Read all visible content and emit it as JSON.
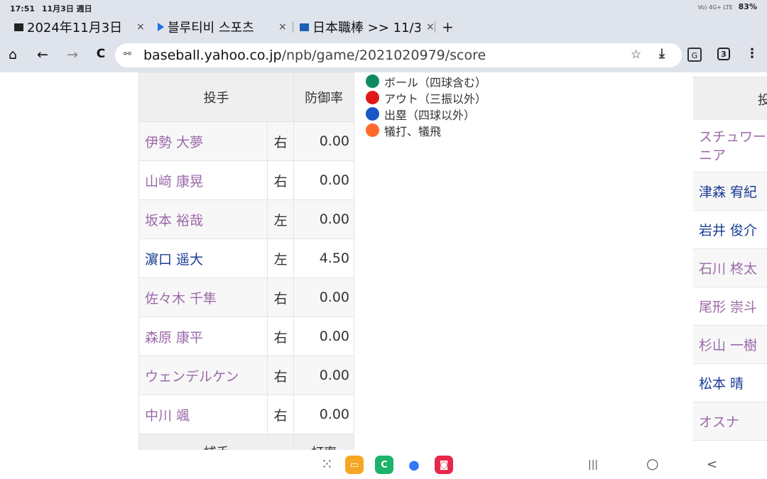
{
  "status_bar": {
    "time": "17:51",
    "date": "11月3日 週日",
    "signal": "Vo) 4G+ LTE",
    "battery": "83%"
  },
  "tabs": [
    {
      "label": "2024年11月3日",
      "close": "×",
      "color": "#222222"
    },
    {
      "label": "블루티비 스포츠",
      "close": "×",
      "color": "#1a73e8"
    },
    {
      "label": "日本職棒 >> 11/3",
      "close": "×",
      "color": "#1c5fb5"
    }
  ],
  "new_tab": "+",
  "toolbar": {
    "home_icon": "⌂",
    "back_icon": "←",
    "forward_icon": "→",
    "reload_icon": "C",
    "url_host": "baseball.yahoo.co.jp",
    "url_path": "/npb/game/2021020979/score",
    "star_icon": "☆",
    "download_icon": "⤓",
    "translate_icon": "G",
    "tab_count": "3",
    "menu_icon": "⋮"
  },
  "pitchers": {
    "headers": {
      "name": "投手",
      "era": "防御率"
    },
    "rows": [
      {
        "name": "伊勢 大夢",
        "hand": "右",
        "era": "0.00",
        "visited": true
      },
      {
        "name": "山﨑 康晃",
        "hand": "右",
        "era": "0.00",
        "visited": true
      },
      {
        "name": "坂本 裕哉",
        "hand": "左",
        "era": "0.00",
        "visited": true
      },
      {
        "name": "濵口 遥大",
        "hand": "左",
        "era": "4.50",
        "visited": false
      },
      {
        "name": "佐々木 千隼",
        "hand": "右",
        "era": "0.00",
        "visited": true
      },
      {
        "name": "森原 康平",
        "hand": "右",
        "era": "0.00",
        "visited": true
      },
      {
        "name": "ウェンデルケン",
        "hand": "右",
        "era": "0.00",
        "visited": true
      },
      {
        "name": "中川 颯",
        "hand": "右",
        "era": "0.00",
        "visited": true
      }
    ],
    "catcher_headers": {
      "name": "捕手",
      "avg": "打率"
    }
  },
  "legend": [
    {
      "label": "ボール（四球含む）",
      "color": "#0e8a5f"
    },
    {
      "label": "アウト（三振以外）",
      "color": "#e01818"
    },
    {
      "label": "出塁（四球以外）",
      "color": "#1a56c4"
    },
    {
      "label": "犠打、犠飛",
      "color": "#ff6a2a"
    }
  ],
  "right_table": {
    "header": "投",
    "rows": [
      {
        "name": "スチュワー ニア",
        "visited": true
      },
      {
        "name": "津森 宥紀",
        "visited": false
      },
      {
        "name": "岩井 俊介",
        "visited": false
      },
      {
        "name": "石川 柊太",
        "visited": true
      },
      {
        "name": "尾形 崇斗",
        "visited": true
      },
      {
        "name": "杉山 一樹",
        "visited": true
      },
      {
        "name": "松本 晴",
        "visited": false
      },
      {
        "name": "オスナ",
        "visited": true
      }
    ]
  },
  "nav_bar": {
    "apps": [
      {
        "name": "files-app-icon",
        "color": "#f5a623",
        "glyph": "▭"
      },
      {
        "name": "phone-app-icon",
        "color": "#1db36b",
        "glyph": "C"
      },
      {
        "name": "messages-app-icon",
        "color": "#3478f6",
        "glyph": "●"
      },
      {
        "name": "camera-app-icon",
        "color": "#e8264b",
        "glyph": "◙"
      }
    ],
    "grid_icon": "⁙",
    "recents_icon": "|||",
    "home_icon": "○",
    "back_icon": "<"
  }
}
